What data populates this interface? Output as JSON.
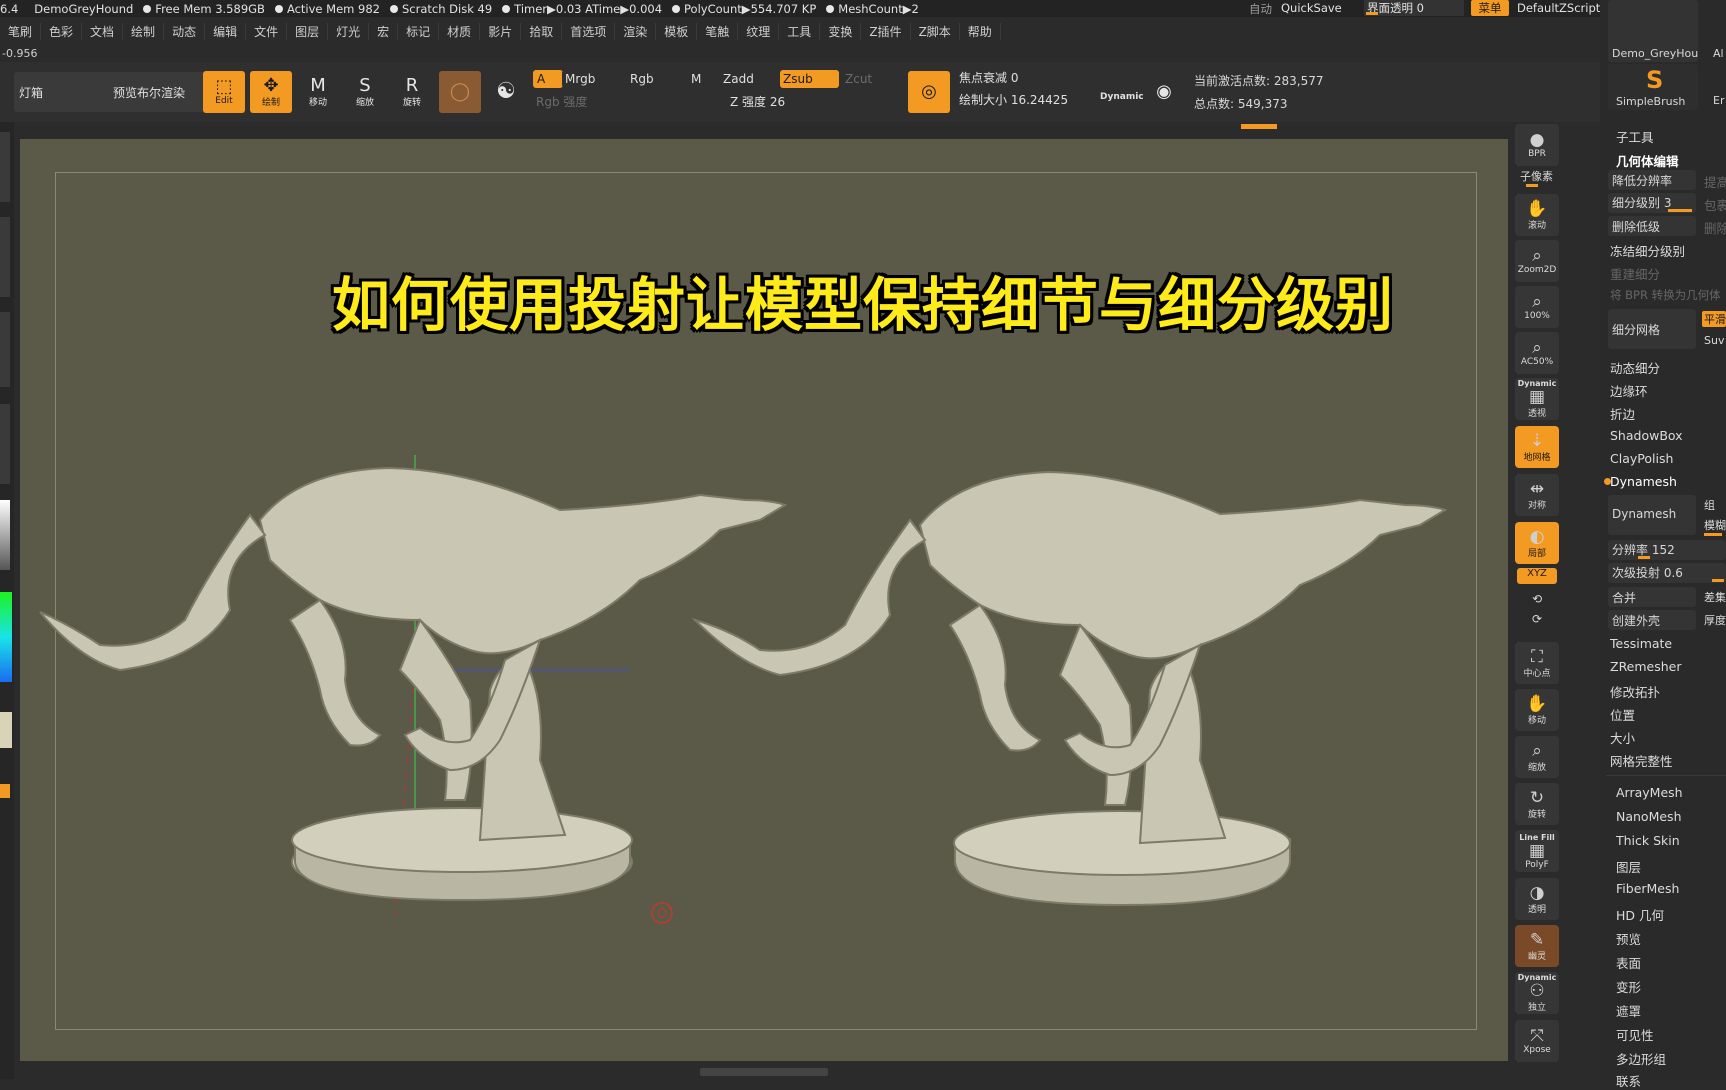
{
  "status": {
    "version": "6.4",
    "doc_name": "DemoGreyHound",
    "free_mem": "Free Mem 3.589GB",
    "active_mem": "Active Mem 982",
    "scratch_disk": "Scratch Disk 49",
    "timer": "Timer▶0.03 ATime▶0.004",
    "polycount": "PolyCount▶554.707 KP",
    "meshcount": "MeshCount▶2",
    "auto": "自动",
    "quicksave": "QuickSave",
    "transparency": "界面透明 0",
    "menu": "菜单",
    "script": "DefaultZScript"
  },
  "menu": [
    "笔刷",
    "色彩",
    "文档",
    "绘制",
    "动态",
    "编辑",
    "文件",
    "图层",
    "灯光",
    "宏",
    "标记",
    "材质",
    "影片",
    "拾取",
    "首选项",
    "渲染",
    "模板",
    "笔触",
    "纹理",
    "工具",
    "变换",
    "Z插件",
    "Z脚本",
    "帮助"
  ],
  "coord_readout": "-0.956",
  "toolbar": {
    "lightbox": "灯箱",
    "bpr_preview": "预览布尔渲染",
    "edit": "Edit",
    "draw": "绘制",
    "move": "移动",
    "scale": "缩放",
    "rotate": "旋转",
    "a": "A",
    "mrgb": "Mrgb",
    "rgb": "Rgb",
    "m": "M",
    "rgb_intensity": "Rgb 强度",
    "zadd": "Zadd",
    "zsub": "Zsub",
    "zcut": "Zcut",
    "z_intensity": "Z 强度 26",
    "focal_shift": "焦点衰减 0",
    "draw_size": "绘制大小 16.24425",
    "dynamic": "Dynamic",
    "active_points": "当前激活点数: 283,577",
    "total_points": "总点数: 549,373"
  },
  "title": "如何使用投射让模型保持细节与细分级别",
  "shelf": [
    "BPR",
    "子像素",
    "滚动",
    "Zoom2D",
    "100%",
    "AC50%",
    "Dynamic",
    "透视",
    "地网格",
    "对称",
    "局部",
    "XYZ",
    "中心点",
    "移动",
    "缩放",
    "旋转",
    "Line Fill",
    "PolyF",
    "透明",
    "幽灵",
    "Dynamic",
    "独立",
    "Xpose"
  ],
  "panel": {
    "top_tool_1": "Demo_GreyHou",
    "top_tool_1b": "Al",
    "top_tool_2": "SimpleBrush",
    "top_tool_2b": "Er",
    "subtool": "子工具",
    "geometry": "几何体编辑",
    "lower_res": "降低分辨率",
    "higher_res": "提高",
    "sdiv": "细分级别 3",
    "cage": "包裹",
    "del_lower": "删除低级",
    "del_higher": "删除",
    "freeze": "冻结细分级别",
    "reconstruct": "重建细分",
    "bpr_to_geo": "将 BPR 转换为几何体",
    "divide": "细分网格",
    "smooth": "平滑",
    "suv": "Suv",
    "dynamic_subdiv": "动态细分",
    "edge_loop": "边缘环",
    "crease": "折边",
    "shadowbox": "ShadowBox",
    "claypolish": "ClayPolish",
    "dynamesh_header": "Dynamesh",
    "dynamesh_btn": "Dynamesh",
    "group": "组",
    "blur": "模糊",
    "resolution": "分辨率 152",
    "subproject": "次级投射 0.6",
    "add": "合并",
    "sub": "差集",
    "create_shell": "创建外壳",
    "thickness": "厚度",
    "tessimate": "Tessimate",
    "zremesher": "ZRemesher",
    "modify_topo": "修改拓扑",
    "position": "位置",
    "size": "大小",
    "mesh_integrity": "网格完整性",
    "arraymesh": "ArrayMesh",
    "nanomesh": "NanoMesh",
    "thickskin": "Thick Skin",
    "layers": "图层",
    "fibermesh": "FiberMesh",
    "hd_geometry": "HD 几何",
    "preview": "预览",
    "surface": "表面",
    "deformation": "变形",
    "masking": "遮罩",
    "visibility": "可见性",
    "polygroups": "多边形组",
    "contact": "联系"
  },
  "colors": {
    "accent": "#f39a22",
    "title_yellow": "#ffeb1a",
    "canvas_bg": "#5b5a48"
  }
}
